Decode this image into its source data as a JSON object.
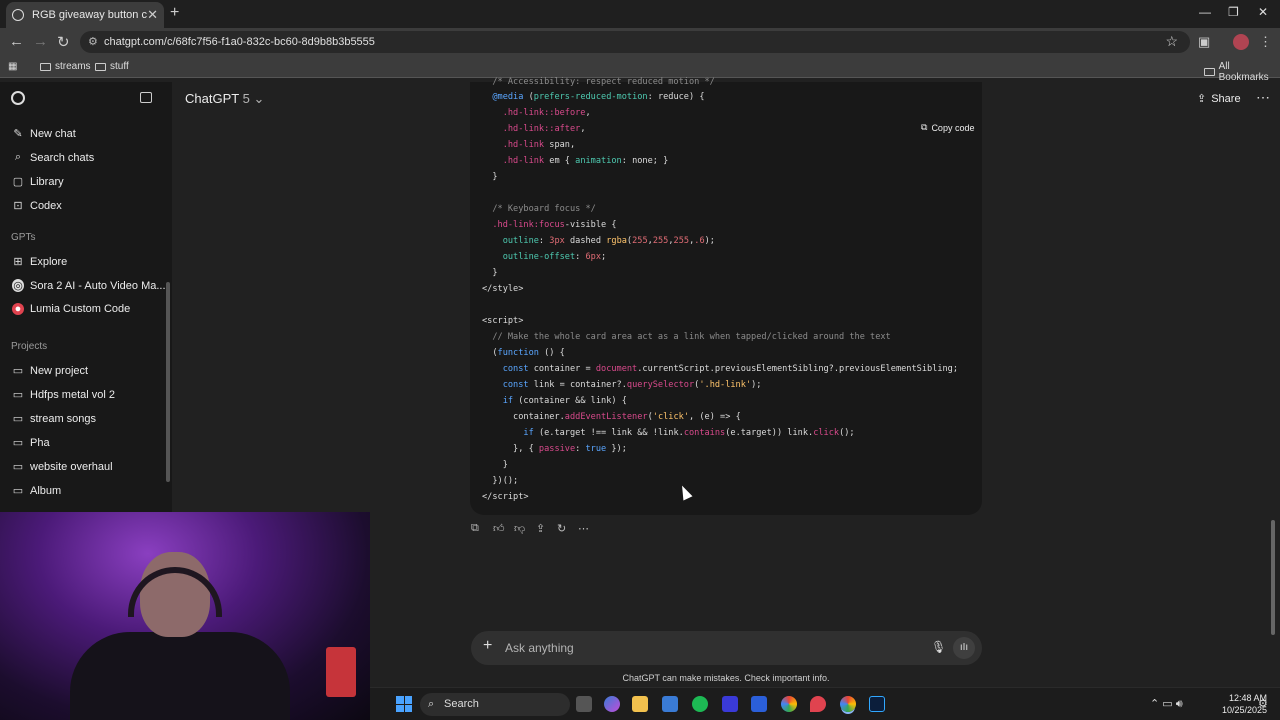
{
  "browser": {
    "tab_title": "RGB giveaway button code",
    "url": "chatgpt.com/c/68fc7f56-f1a0-832c-bc60-8d9b8b3b5555",
    "bookmarks": [
      "streams",
      "stuff"
    ],
    "all_bookmarks": "All Bookmarks"
  },
  "sidebar": {
    "top_items": [
      {
        "label": "New chat",
        "icon": "edit-icon"
      },
      {
        "label": "Search chats",
        "icon": "search-icon"
      },
      {
        "label": "Library",
        "icon": "library-icon"
      },
      {
        "label": "Codex",
        "icon": "codex-icon"
      }
    ],
    "gpts_heading": "GPTs",
    "gpts": [
      {
        "label": "Explore",
        "icon": "grid-icon"
      },
      {
        "label": "Sora 2 AI - Auto Video Ma...",
        "icon": "sora-icon"
      },
      {
        "label": "Lumia Custom Code",
        "icon": "lumia-icon"
      }
    ],
    "projects_heading": "Projects",
    "projects": [
      {
        "label": "New project"
      },
      {
        "label": "Hdfps metal vol 2"
      },
      {
        "label": "stream songs"
      },
      {
        "label": "Pha"
      },
      {
        "label": "website overhaul"
      },
      {
        "label": "Album"
      }
    ]
  },
  "header": {
    "model_name": "ChatGPT",
    "model_version": "5",
    "share_label": "Share"
  },
  "code": {
    "copy_label": "Copy code"
  },
  "composer": {
    "placeholder": "Ask anything",
    "disclaimer": "ChatGPT can make mistakes. Check important info."
  },
  "taskbar": {
    "search_label": "Search",
    "time": "12:48 AM",
    "date": "10/25/2025"
  },
  "colors": {
    "background": "#212121",
    "sidebar": "#181818",
    "code_bg": "#181818",
    "keyword": "#5aa6ff",
    "selector": "#d94a8c",
    "string": "#ffc46b"
  }
}
